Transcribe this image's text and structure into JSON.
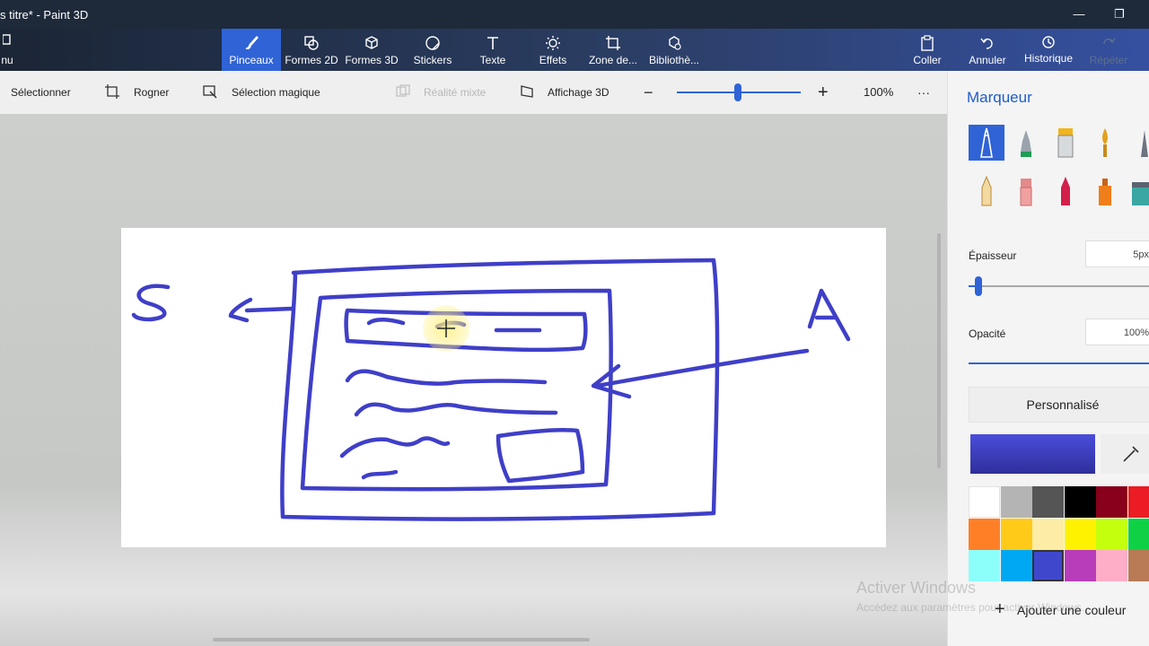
{
  "window": {
    "title": "s titre* - Paint 3D",
    "menu_label": "nu"
  },
  "ribbon": {
    "tabs": [
      {
        "label": "Pinceaux",
        "icon": "brush-icon",
        "active": true
      },
      {
        "label": "Formes 2D",
        "icon": "shapes-2d-icon"
      },
      {
        "label": "Formes 3D",
        "icon": "cube-icon"
      },
      {
        "label": "Stickers",
        "icon": "sticker-icon"
      },
      {
        "label": "Texte",
        "icon": "text-icon"
      },
      {
        "label": "Effets",
        "icon": "sun-icon"
      },
      {
        "label": "Zone de...",
        "icon": "crop-icon"
      },
      {
        "label": "Bibliothè...",
        "icon": "library-icon"
      }
    ],
    "actions": {
      "paste": "Coller",
      "undo": "Annuler",
      "history": "Historique",
      "redo": "Répéter"
    }
  },
  "toolbar": {
    "select": "Sélectionner",
    "crop": "Rogner",
    "magic_select": "Sélection magique",
    "mixed_reality": "Réalité mixte",
    "view_3d": "Affichage 3D",
    "zoom_value": "100%",
    "zoom_level": 0.5,
    "more": "···"
  },
  "panel": {
    "title": "Marqueur",
    "brushes": [
      "marker",
      "calligraphy-pen",
      "oil-brush",
      "watercolor",
      "pixel-pen",
      "pencil",
      "eraser",
      "crayon",
      "spray-can",
      "fill"
    ],
    "selected_brush": "marker",
    "thickness_label": "Épaisseur",
    "thickness_value": "5px",
    "opacity_label": "Opacité",
    "opacity_value": "100%",
    "color_select": "Personnalisé",
    "current_color": "#3f3fc8",
    "palette": [
      [
        "#ffffff",
        "#b4b4b4",
        "#555555",
        "#000000",
        "#88001b",
        "#ec1c24"
      ],
      [
        "#ff7f27",
        "#ffca18",
        "#fdeca6",
        "#fff200",
        "#c4ff0e",
        "#0ed145"
      ],
      [
        "#8cfffb",
        "#00a8f3",
        "#3f48cc",
        "#b83dba",
        "#ffaec8",
        "#b97a56"
      ]
    ],
    "add_color": "Ajouter une couleur"
  },
  "watermark": {
    "line1": "Activer Windows",
    "line2": "Accédez aux paramètres pour activer Windows."
  }
}
